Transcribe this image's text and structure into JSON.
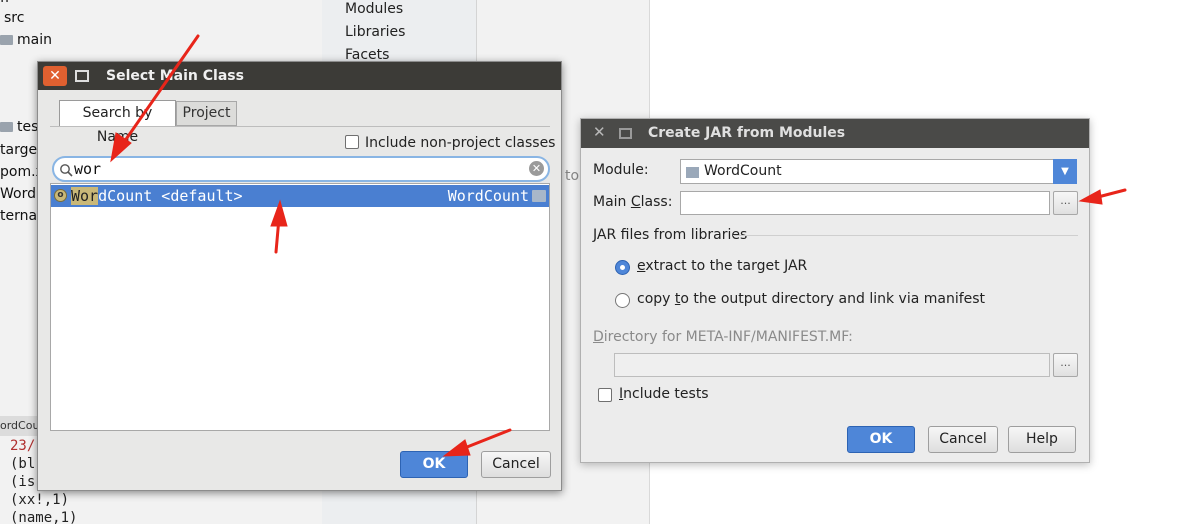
{
  "project_tree": {
    "items": [
      "src",
      "main",
      "tes",
      "targe",
      "pom.x",
      "Word",
      "ternal"
    ]
  },
  "bottom_tab": "ordCou",
  "console": {
    "lines": [
      "23/",
      "(bl",
      "(is",
      "(xx!,1)",
      "(name,1)"
    ]
  },
  "structure_list": {
    "items": [
      "Modules",
      "Libraries",
      "Facets"
    ]
  },
  "background_text": "to",
  "select_main_class": {
    "title": "Select Main Class",
    "tabs": [
      "Search by Name",
      "Project"
    ],
    "include_non_project": "Include non-project classes",
    "search_value": "wor",
    "result": {
      "match": "Wor",
      "rest": "dCount <default>",
      "module": "WordCount",
      "icon": "class-icon"
    },
    "ok_label": "OK",
    "cancel_label": "Cancel",
    "close_glyph": "✕"
  },
  "create_jar": {
    "title": "Create JAR from Modules",
    "module_label": "Module:",
    "module_value": "WordCount",
    "main_class_label_pre": "Main ",
    "main_class_label_u": "C",
    "main_class_label_post": "lass:",
    "main_class_value": "",
    "browse_label": "...",
    "jar_section_label": "JAR files from libraries",
    "radio_extract_u": "e",
    "radio_extract_rest": "xtract to the target JAR",
    "radio_copy_pre": "copy ",
    "radio_copy_u": "t",
    "radio_copy_rest": "o the output directory and link via manifest",
    "manifest_dir_u": "D",
    "manifest_dir_rest": "irectory for META-INF/MANIFEST.MF:",
    "include_tests_u": "I",
    "include_tests_rest": "nclude tests",
    "ok_label": "OK",
    "cancel_label": "Cancel",
    "help_label": "Help",
    "close_glyph": "✕"
  },
  "colors": {
    "accent": "#4e86d8",
    "titlebar_dark": "#3c3b37",
    "close_orange": "#e06030",
    "annotation_red": "#e8251a"
  }
}
